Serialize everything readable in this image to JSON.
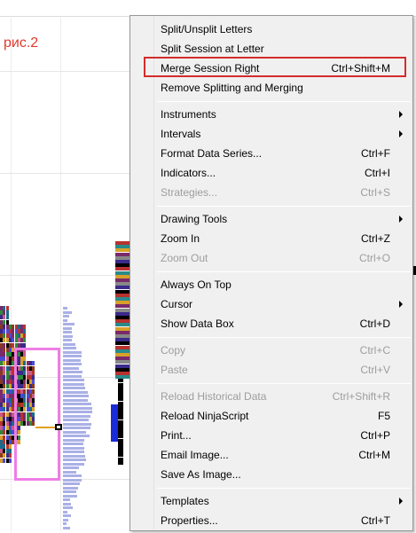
{
  "caption": "рис.2",
  "colors": {
    "caption": "#e03a2e",
    "highlight_border": "#d42c2c",
    "pink_box": "#ee7ee6",
    "volume_bars": "#aab0e6",
    "blue_bar": "#1a2bd8"
  },
  "menu": {
    "items": [
      {
        "label": "Split/Unsplit Letters",
        "shortcut": "",
        "disabled": false,
        "submenu": false
      },
      {
        "label": "Split Session at Letter",
        "shortcut": "",
        "disabled": false,
        "submenu": false
      },
      {
        "label": "Merge Session Right",
        "shortcut": "Ctrl+Shift+M",
        "disabled": false,
        "submenu": false,
        "highlighted": true
      },
      {
        "label": "Remove Splitting and Merging",
        "shortcut": "",
        "disabled": false,
        "submenu": false
      },
      {
        "label": "Instruments",
        "shortcut": "",
        "disabled": false,
        "submenu": true
      },
      {
        "label": "Intervals",
        "shortcut": "",
        "disabled": false,
        "submenu": true
      },
      {
        "label": "Format Data Series...",
        "shortcut": "Ctrl+F",
        "disabled": false,
        "submenu": false
      },
      {
        "label": "Indicators...",
        "shortcut": "Ctrl+I",
        "disabled": false,
        "submenu": false
      },
      {
        "label": "Strategies...",
        "shortcut": "Ctrl+S",
        "disabled": true,
        "submenu": false
      },
      {
        "label": "Drawing Tools",
        "shortcut": "",
        "disabled": false,
        "submenu": true
      },
      {
        "label": "Zoom In",
        "shortcut": "Ctrl+Z",
        "disabled": false,
        "submenu": false
      },
      {
        "label": "Zoom Out",
        "shortcut": "Ctrl+O",
        "disabled": true,
        "submenu": false
      },
      {
        "label": "Always On Top",
        "shortcut": "",
        "disabled": false,
        "submenu": false
      },
      {
        "label": "Cursor",
        "shortcut": "",
        "disabled": false,
        "submenu": true
      },
      {
        "label": "Show Data Box",
        "shortcut": "Ctrl+D",
        "disabled": false,
        "submenu": false
      },
      {
        "label": "Copy",
        "shortcut": "Ctrl+C",
        "disabled": true,
        "submenu": false
      },
      {
        "label": "Paste",
        "shortcut": "Ctrl+V",
        "disabled": true,
        "submenu": false
      },
      {
        "label": "Reload Historical Data",
        "shortcut": "Ctrl+Shift+R",
        "disabled": true,
        "submenu": false
      },
      {
        "label": "Reload NinjaScript",
        "shortcut": "F5",
        "disabled": false,
        "submenu": false
      },
      {
        "label": "Print...",
        "shortcut": "Ctrl+P",
        "disabled": false,
        "submenu": false
      },
      {
        "label": "Email Image...",
        "shortcut": "Ctrl+M",
        "disabled": false,
        "submenu": false
      },
      {
        "label": "Save As Image...",
        "shortcut": "",
        "disabled": false,
        "submenu": false
      },
      {
        "label": "Templates",
        "shortcut": "",
        "disabled": false,
        "submenu": true
      },
      {
        "label": "Properties...",
        "shortcut": "Ctrl+T",
        "disabled": false,
        "submenu": false
      }
    ]
  }
}
